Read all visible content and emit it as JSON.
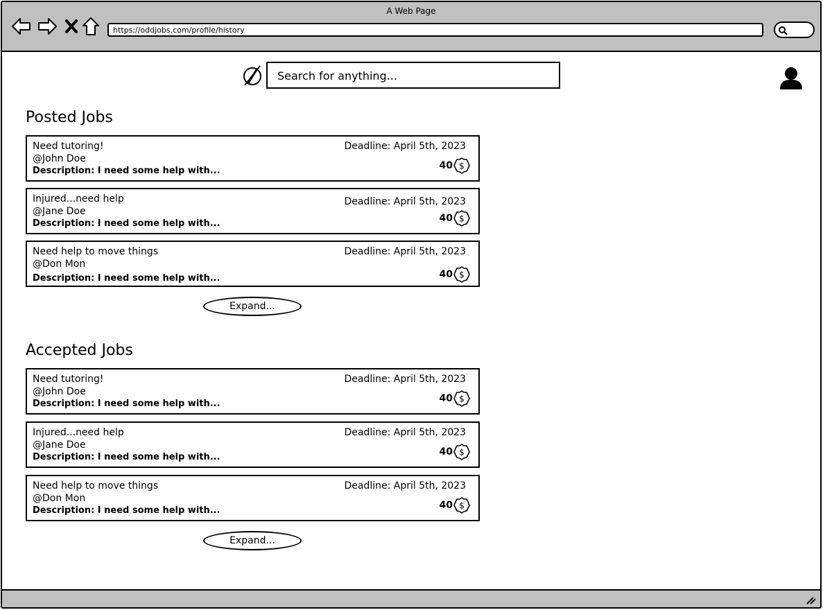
{
  "browser": {
    "title": "A Web Page",
    "url": "https://oddjobs.com/profile/history"
  },
  "search": {
    "placeholder": "Search for anything..."
  },
  "posted": {
    "title": "Posted Jobs",
    "expand_label": "Expand...",
    "jobs": [
      {
        "title": "Need tutoring!",
        "user": "@John Doe",
        "description": "Description: I need some help with...",
        "deadline": "Deadline: April 5th, 2023",
        "price": "40"
      },
      {
        "title": "Injured...need help",
        "user": "@Jane Doe",
        "description": "Description: I need some help with...",
        "deadline": "Deadline: April 5th, 2023",
        "price": "40"
      },
      {
        "title": "Need help to move things",
        "user": "@Don Mon",
        "description": "Description: I need some help with...",
        "deadline": "Deadline: April 5th, 2023",
        "price": "40"
      }
    ]
  },
  "accepted": {
    "title": "Accepted Jobs",
    "expand_label": "Expand...",
    "jobs": [
      {
        "title": "Need tutoring!",
        "user": "@John Doe",
        "description": "Description: I need some help with...",
        "deadline": "Deadline: April 5th, 2023",
        "price": "40"
      },
      {
        "title": "Injured...need help",
        "user": "@Jane Doe",
        "description": "Description: I need some help with...",
        "deadline": "Deadline: April 5th, 2023",
        "price": "40"
      },
      {
        "title": "Need help to move things",
        "user": "@Don Mon",
        "description": "Description: I need some help with...",
        "deadline": "Deadline: April 5th, 2023",
        "price": "40"
      }
    ]
  },
  "icons": {
    "back": "back-arrow-icon",
    "forward": "forward-arrow-icon",
    "stop": "close-icon",
    "home": "home-icon",
    "search": "search-icon",
    "logo": "compass-icon",
    "user": "user-icon",
    "price": "dollar-coin-icon"
  }
}
